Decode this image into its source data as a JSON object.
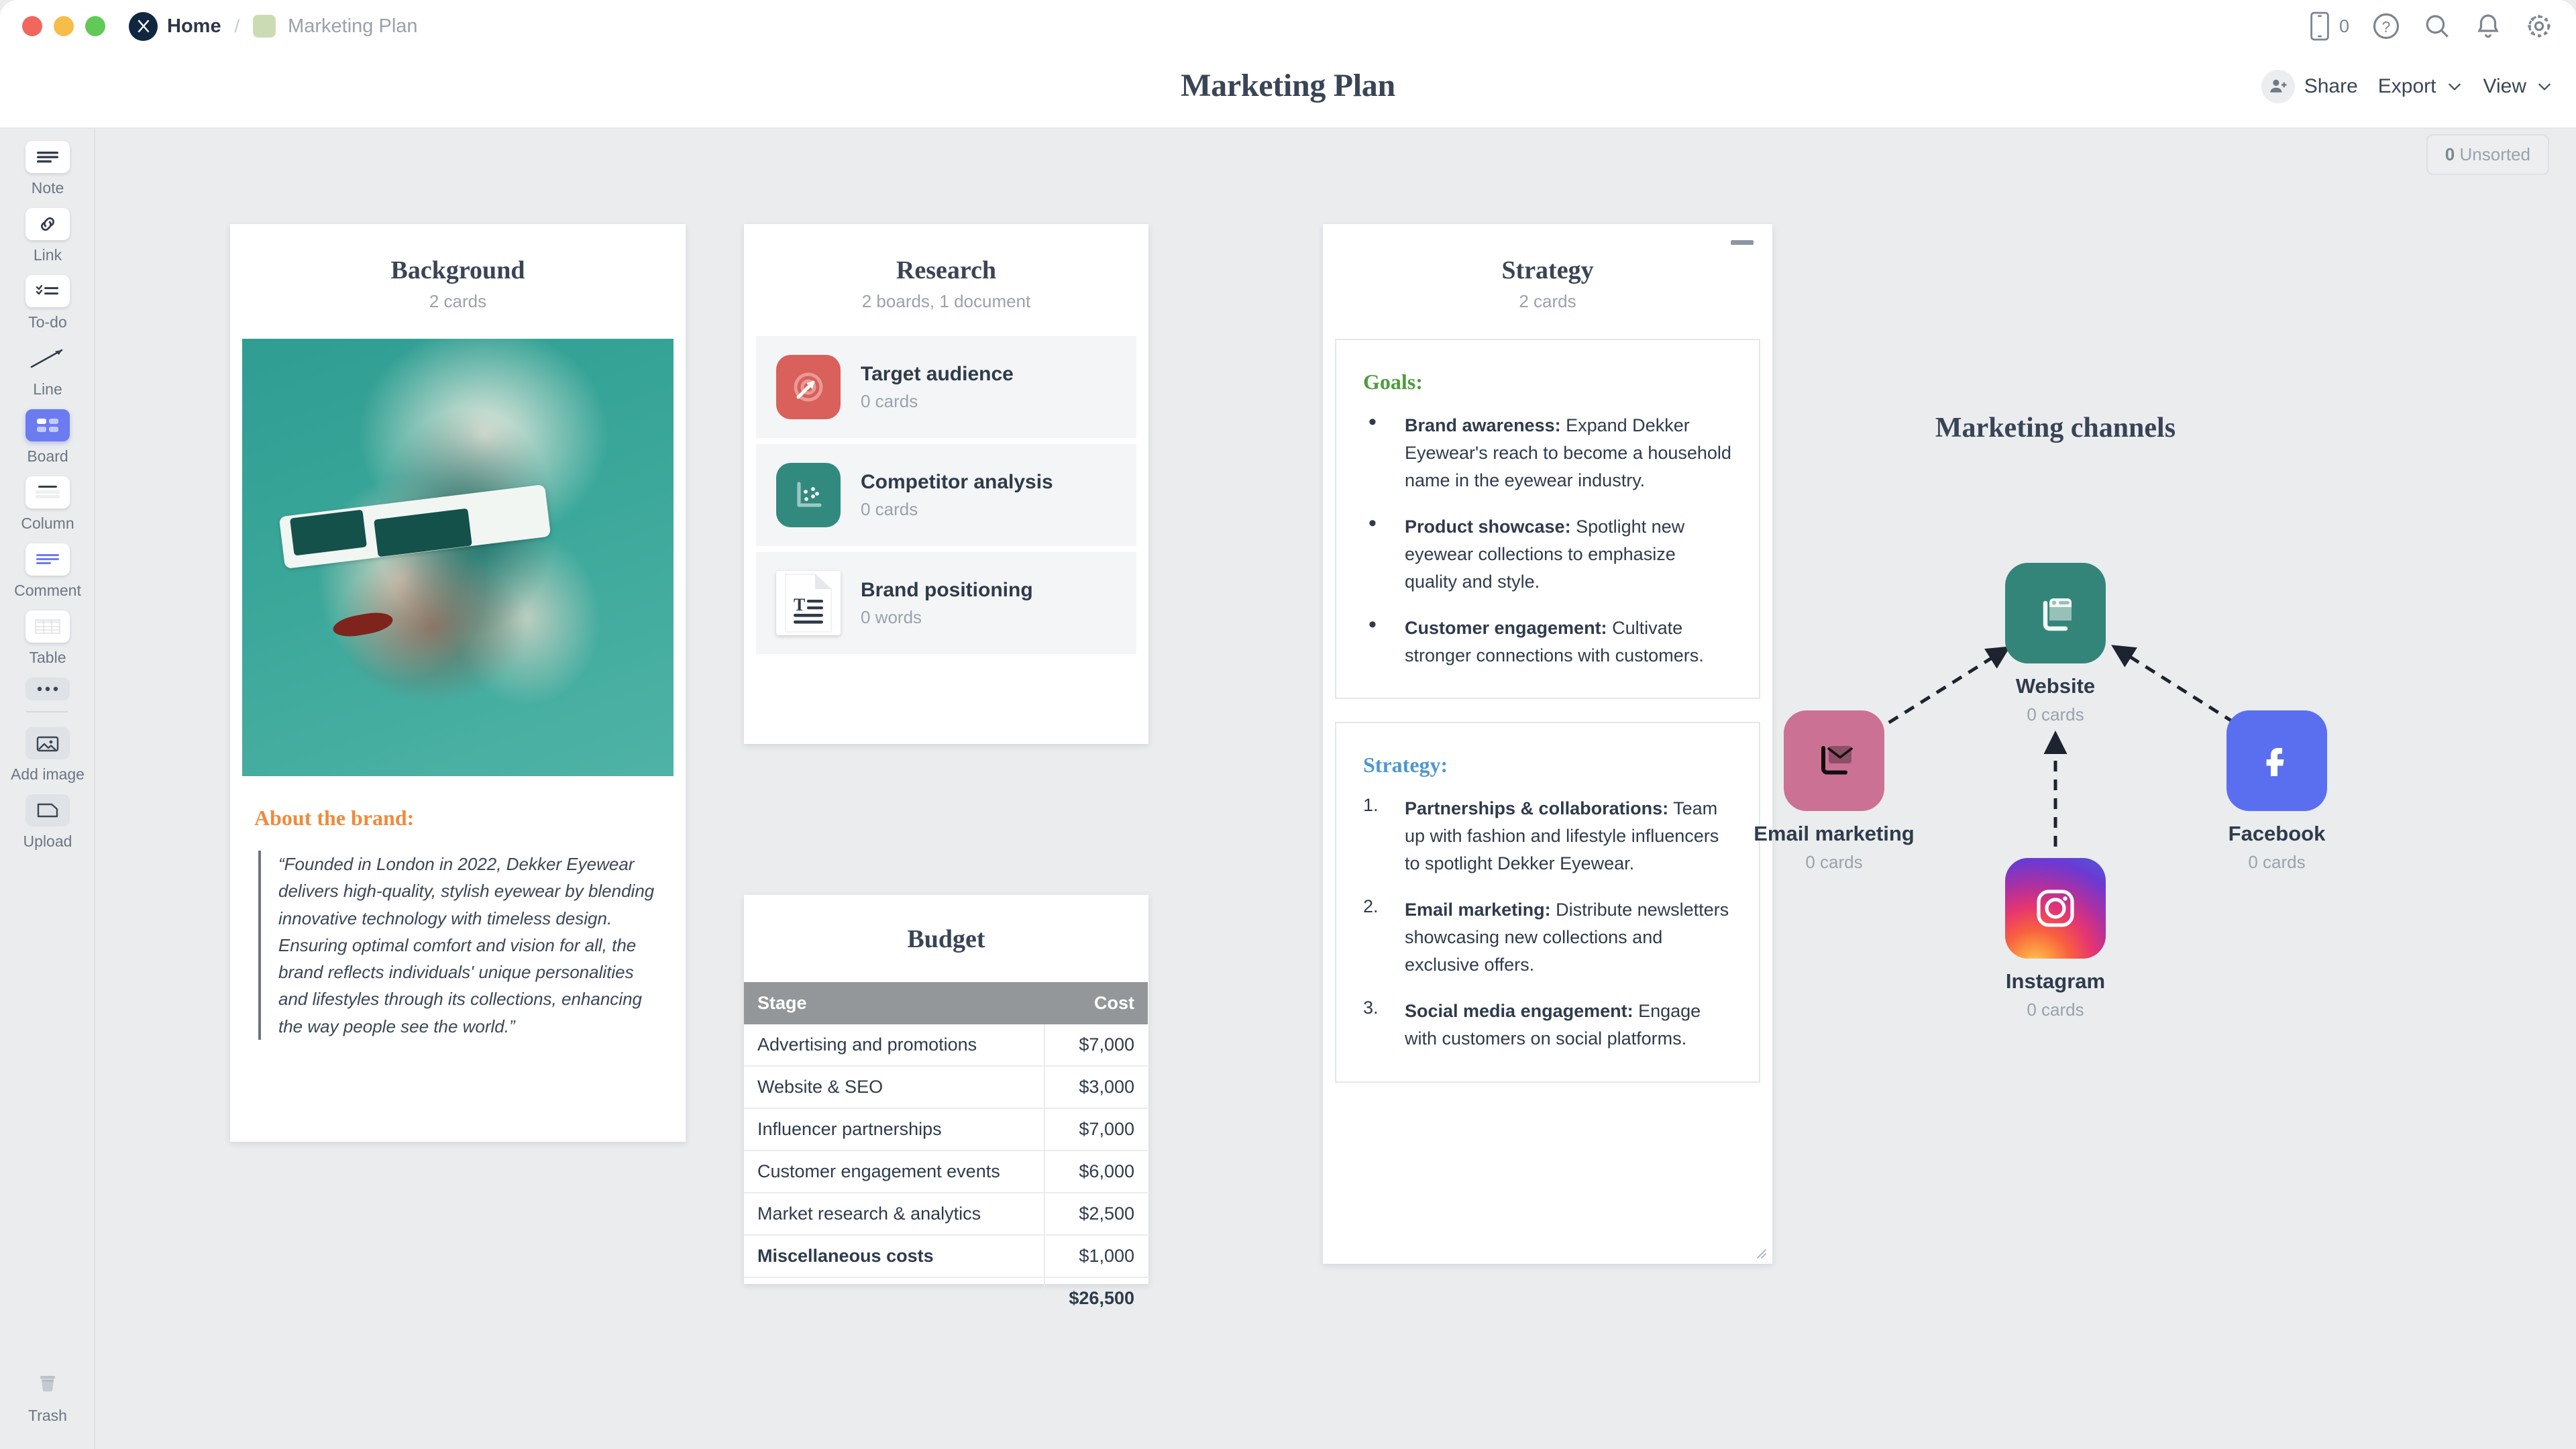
{
  "window": {
    "traffic_lights": [
      "close",
      "minimize",
      "zoom"
    ],
    "breadcrumb": {
      "home": "Home",
      "separator": "/",
      "current": "Marketing Plan"
    }
  },
  "topbar": {
    "device_count": "0",
    "icons": [
      "mobile-preview-icon",
      "help-icon",
      "search-icon",
      "notifications-icon",
      "settings-icon"
    ]
  },
  "header": {
    "title": "Marketing Plan",
    "share_label": "Share",
    "export_label": "Export",
    "view_label": "View"
  },
  "toolbar": {
    "items": [
      {
        "label": "Note",
        "icon": "note-icon"
      },
      {
        "label": "Link",
        "icon": "link-icon"
      },
      {
        "label": "To-do",
        "icon": "todo-icon"
      },
      {
        "label": "Line",
        "icon": "line-icon"
      },
      {
        "label": "Board",
        "icon": "board-icon"
      },
      {
        "label": "Column",
        "icon": "column-icon"
      },
      {
        "label": "Comment",
        "icon": "comment-icon"
      },
      {
        "label": "Table",
        "icon": "table-icon"
      },
      {
        "label": "",
        "icon": "more-icon"
      },
      {
        "label": "Add image",
        "icon": "add-image-icon"
      },
      {
        "label": "Upload",
        "icon": "upload-icon"
      }
    ],
    "trash_label": "Trash"
  },
  "canvas": {
    "unsorted_count": "0",
    "unsorted_label": "Unsorted"
  },
  "background_card": {
    "title": "Background",
    "subtitle": "2 cards",
    "image_alt": "woman with white sunglasses on teal background",
    "brand_heading": "About the brand:",
    "brand_quote": "“Founded in London in 2022, Dekker Eyewear delivers high-quality, stylish eyewear by blending innovative technology with timeless design. Ensuring optimal comfort and vision for all, the brand reflects individuals' unique personalities and lifestyles through its collections, enhancing the way people see the world.”"
  },
  "research_card": {
    "title": "Research",
    "subtitle": "2 boards, 1 document",
    "items": [
      {
        "name": "Target audience",
        "meta": "0 cards",
        "icon": "target-icon"
      },
      {
        "name": "Competitor analysis",
        "meta": "0 cards",
        "icon": "scatter-plot-icon"
      },
      {
        "name": "Brand positioning",
        "meta": "0 words",
        "icon": "document-icon"
      }
    ]
  },
  "budget_card": {
    "title": "Budget",
    "columns": [
      "Stage",
      "Cost"
    ],
    "rows": [
      {
        "stage": "Advertising and promotions",
        "cost": "$7,000",
        "bold": false
      },
      {
        "stage": "Website & SEO",
        "cost": "$3,000",
        "bold": false
      },
      {
        "stage": "Influencer partnerships",
        "cost": "$7,000",
        "bold": false
      },
      {
        "stage": "Customer engagement events",
        "cost": "$6,000",
        "bold": false
      },
      {
        "stage": "Market research & analytics",
        "cost": "$2,500",
        "bold": false
      },
      {
        "stage": "Miscellaneous costs",
        "cost": "$1,000",
        "bold": true
      }
    ],
    "total": {
      "stage": "",
      "cost": "$26,500"
    }
  },
  "strategy_card": {
    "title": "Strategy",
    "subtitle": "2 cards",
    "goals": {
      "heading": "Goals:",
      "items": [
        {
          "marker": "•",
          "lead": "Brand awareness:",
          "text": " Expand Dekker Eyewear's reach to become a household name in the eyewear industry."
        },
        {
          "marker": "•",
          "lead": "Product showcase:",
          "text": " Spotlight new eyewear collections to emphasize quality and style."
        },
        {
          "marker": "•",
          "lead": "Customer engagement:",
          "text": " Cultivate stronger connections with customers."
        }
      ]
    },
    "strategy": {
      "heading": "Strategy:",
      "items": [
        {
          "marker": "1.",
          "lead": "Partnerships & collaborations:",
          "text": " Team up with fashion and lifestyle influencers to spotlight Dekker Eyewear."
        },
        {
          "marker": "2.",
          "lead": "Email marketing:",
          "text": " Distribute newsletters showcasing new collections and exclusive offers."
        },
        {
          "marker": "3.",
          "lead": "Social media engagement:",
          "text": " Engage with customers on social platforms."
        }
      ]
    }
  },
  "marketing_channels": {
    "title": "Marketing channels",
    "nodes": [
      {
        "name": "Website",
        "meta": "0 cards",
        "icon": "website-icon",
        "color": "#348579"
      },
      {
        "name": "Email marketing",
        "meta": "0 cards",
        "icon": "email-icon",
        "color": "#cb7294"
      },
      {
        "name": "Instagram",
        "meta": "0 cards",
        "icon": "instagram-icon",
        "color": "#e8366f"
      },
      {
        "name": "Facebook",
        "meta": "0 cards",
        "icon": "facebook-icon",
        "color": "#5a6ff0"
      }
    ],
    "connections": [
      {
        "from": "Email marketing",
        "to": "Website",
        "style": "dashed-arrow"
      },
      {
        "from": "Instagram",
        "to": "Website",
        "style": "dashed-arrow"
      },
      {
        "from": "Facebook",
        "to": "Website",
        "style": "dashed-arrow"
      }
    ]
  },
  "colors": {
    "canvas_bg": "#eaecee",
    "card_bg": "#ffffff",
    "accent_board": "#6b7cf0",
    "brand_orange": "#ee8b3c",
    "goals_green": "#4f9c3f",
    "strategy_blue": "#4e98cf",
    "table_header": "#949799",
    "text_primary": "#2f3b4c",
    "text_muted": "#9aa2ad"
  }
}
